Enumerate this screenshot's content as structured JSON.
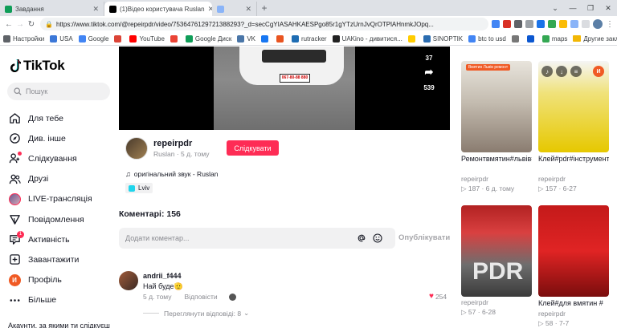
{
  "browser": {
    "tabs": [
      {
        "title": "Завдання",
        "favicon_color": "#0f9d58",
        "active": false
      },
      {
        "title": "(1)Відео користувача Ruslan",
        "favicon_color": "#000000",
        "active": true
      },
      {
        "title": "",
        "favicon_color": "#8ab4f8",
        "active": false
      }
    ],
    "url": "https://www.tiktok.com/@repeirpdr/video/7536476129721388293?_d=secCgYIASAHKAESPgo85r1gYTzUrnJvQrOTPlAHnmkJOpq...",
    "bookmarks": [
      {
        "label": "Настройки",
        "color": "#5f6368"
      },
      {
        "label": "USA",
        "color": "#3c78d8"
      },
      {
        "label": "Google",
        "color": "#4285f4"
      },
      {
        "label": "",
        "color": "#db4437"
      },
      {
        "label": "YouTube",
        "color": "#ff0000"
      },
      {
        "label": "",
        "color": "#ea4335"
      },
      {
        "label": "Google Диск",
        "color": "#0f9d58"
      },
      {
        "label": "VK",
        "color": "#4a76a8"
      },
      {
        "label": "",
        "color": "#1877f2"
      },
      {
        "label": "",
        "color": "#e95420"
      },
      {
        "label": "rutracker",
        "color": "#1f6db3"
      },
      {
        "label": "UAKino - дивитися...",
        "color": "#222222"
      },
      {
        "label": "",
        "color": "#ffcc00"
      },
      {
        "label": "SINOPTIK",
        "color": "#2b6cb0"
      },
      {
        "label": "btc to usd",
        "color": "#4285f4"
      },
      {
        "label": "",
        "color": "#777777"
      },
      {
        "label": "",
        "color": "#0b57d0"
      },
      {
        "label": "maps",
        "color": "#34a853"
      }
    ],
    "other_bookmarks": "Другие закладки"
  },
  "sidebar": {
    "logo": "TikTok",
    "search_placeholder": "Пошук",
    "items": [
      {
        "label": "Для тебе",
        "icon": "home-icon"
      },
      {
        "label": "Див. інше",
        "icon": "compass-icon"
      },
      {
        "label": "Слідкування",
        "icon": "following-icon",
        "dot": true
      },
      {
        "label": "Друзі",
        "icon": "friends-icon"
      },
      {
        "label": "LIVE-трансляція",
        "icon": "live-avatar-icon"
      },
      {
        "label": "Повідомлення",
        "icon": "message-icon"
      },
      {
        "label": "Активність",
        "icon": "activity-icon",
        "badge": "1"
      },
      {
        "label": "Завантажити",
        "icon": "upload-icon"
      },
      {
        "label": "Профіль",
        "icon": "profile-icon",
        "avatar_letter": "И"
      },
      {
        "label": "Більше",
        "icon": "more-icon"
      }
    ],
    "footer": "Акаунти, за якими ти слідкуєш"
  },
  "video": {
    "likes": "37",
    "shares": "539",
    "plate": "067-80-88 880"
  },
  "author": {
    "username": "repeirpdr",
    "name": "Ruslan",
    "date": "5 д. тому",
    "follow_label": "Слідкувати",
    "sound": "оригінальний звук - Ruslan",
    "location": "Lviv"
  },
  "comments": {
    "title": "Коментарі: 156",
    "input_placeholder": "Додати коментар...",
    "publish_label": "Опублікувати",
    "items": [
      {
        "user": "andrii_f444",
        "text": "Най буде🫡",
        "time": "5 д. тому",
        "reply_label": "Відповісти",
        "likes": "254",
        "view_replies": "Переглянути відповіді: 8"
      }
    ]
  },
  "related": [
    {
      "title": "Ремонтвмятин#львів#pdr#україна",
      "author": "repeirpdr",
      "views": "187",
      "date": "6 д. тому",
      "badge": "Вмятин Львів ремонт"
    },
    {
      "title": "Клей#pdr#інструмент#",
      "author": "repeirpdr",
      "views": "157",
      "date": "6-27"
    },
    {
      "title": "",
      "author": "repeirpdr",
      "views": "57",
      "date": "6-28",
      "overlay": "PDR"
    },
    {
      "title": "Клей#для вмятин #",
      "author": "repeirpdr",
      "views": "58",
      "date": "7-7"
    }
  ]
}
